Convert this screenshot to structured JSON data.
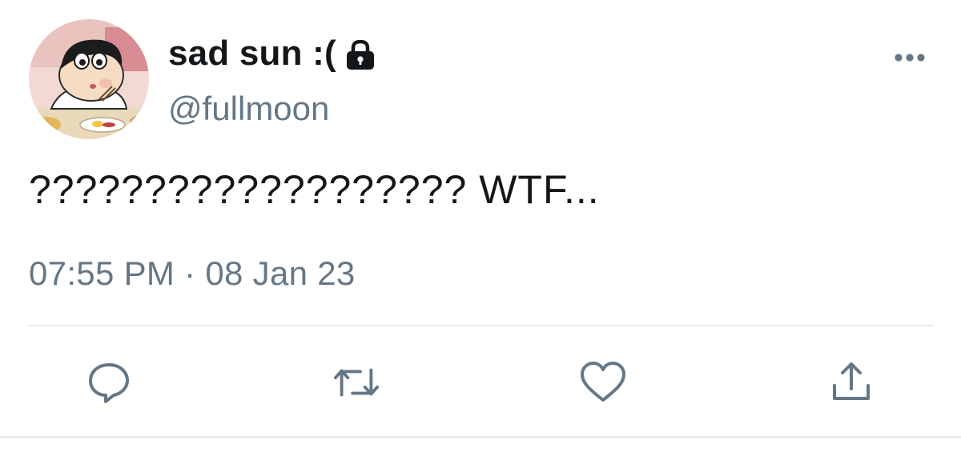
{
  "tweet": {
    "display_name": "sad sun :(",
    "handle": "@fullmoon",
    "text": "??????????????????? WTF...",
    "timestamp": "07:55 PM · 08 Jan 23",
    "protected": true
  },
  "icons": {
    "lock": "lock-icon",
    "more": "more-horizontal-icon",
    "reply": "reply-bubble-icon",
    "retweet": "retweet-arrows-icon",
    "like": "heart-icon",
    "share": "share-upload-icon"
  },
  "colors": {
    "text_primary": "#14171a",
    "text_secondary": "#657786",
    "icon": "#657786",
    "divider": "#e6ecf0"
  }
}
